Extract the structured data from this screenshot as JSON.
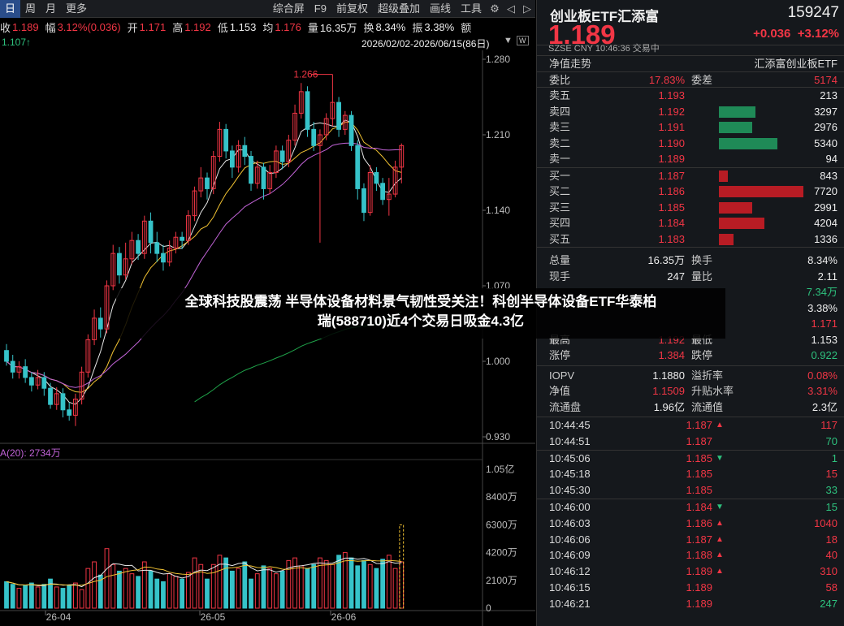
{
  "toolbar": {
    "left": [
      "日",
      "周",
      "月",
      "更多"
    ],
    "right": [
      "综合屏",
      "F9",
      "前复权",
      "超级叠加",
      "画线",
      "工具"
    ]
  },
  "info": {
    "close_label": "收",
    "close": "1.189",
    "amp_label": "幅",
    "amp": "3.12%(0.036)",
    "open_label": "开",
    "open": "1.171",
    "high_label": "高",
    "high": "1.192",
    "low_label": "低",
    "low": "1.153",
    "avg_label": "均",
    "avg": "1.176",
    "vol_label": "量",
    "vol": "16.35万",
    "turn_label": "换",
    "turn": "8.34%",
    "swing_label": "振",
    "swing": "3.38%",
    "extra_label": "额"
  },
  "range": {
    "low_mark": "1.107↑",
    "period": "2026/02/02-2026/06/15(86日)"
  },
  "vol_label": "A(20): 2734万",
  "banner": {
    "line1": "全球科技股震荡 半导体设备材料景气韧性受关注！科创半导体设备ETF华泰柏",
    "line2": "瑞(588710)近4个交易日吸金4.3亿"
  },
  "chart_data": {
    "type": "candlestick",
    "y_ticks": [
      "1.280",
      "1.210",
      "1.140",
      "1.070",
      "1.000",
      "0.930"
    ],
    "y_range": [
      0.93,
      1.28
    ],
    "vol_ticks": [
      "1.05亿",
      "8400万",
      "6300万",
      "4200万",
      "2100万",
      "0"
    ],
    "x_ticks": [
      "26-04",
      "26-05",
      "26-06"
    ],
    "max_label": "1.266",
    "candles": [
      [
        1.01,
        1.0,
        1.016,
        0.996
      ],
      [
        1.0,
        0.99,
        1.006,
        0.984
      ],
      [
        0.99,
        0.995,
        1.0,
        0.984
      ],
      [
        0.995,
        0.985,
        1.002,
        0.98
      ],
      [
        0.985,
        0.978,
        0.99,
        0.972
      ],
      [
        0.978,
        0.985,
        0.992,
        0.974
      ],
      [
        0.985,
        0.975,
        0.99,
        0.968
      ],
      [
        0.975,
        0.96,
        0.98,
        0.956
      ],
      [
        0.96,
        0.97,
        0.976,
        0.955
      ],
      [
        0.97,
        0.955,
        0.975,
        0.948
      ],
      [
        0.955,
        0.95,
        0.962,
        0.945
      ],
      [
        0.95,
        0.965,
        0.97,
        0.94
      ],
      [
        0.965,
        0.99,
        0.995,
        0.96
      ],
      [
        0.99,
        1.02,
        1.025,
        0.985
      ],
      [
        1.02,
        1.04,
        1.048,
        1.015
      ],
      [
        1.04,
        1.03,
        1.05,
        1.022
      ],
      [
        1.03,
        1.07,
        1.075,
        1.026
      ],
      [
        1.07,
        1.1,
        1.108,
        1.066
      ],
      [
        1.1,
        1.08,
        1.106,
        1.072
      ],
      [
        1.08,
        1.095,
        1.11,
        1.076
      ],
      [
        1.095,
        1.112,
        1.12,
        1.09
      ],
      [
        1.112,
        1.1,
        1.118,
        1.094
      ],
      [
        1.1,
        1.13,
        1.135,
        1.095
      ],
      [
        1.13,
        1.11,
        1.138,
        1.1
      ],
      [
        1.11,
        1.1,
        1.12,
        1.092
      ],
      [
        1.1,
        1.092,
        1.108,
        1.084
      ],
      [
        1.092,
        1.105,
        1.112,
        1.088
      ],
      [
        1.105,
        1.115,
        1.12,
        1.1
      ],
      [
        1.115,
        1.112,
        1.12,
        1.104
      ],
      [
        1.112,
        1.135,
        1.14,
        1.108
      ],
      [
        1.135,
        1.158,
        1.162,
        1.13
      ],
      [
        1.158,
        1.17,
        1.18,
        1.152
      ],
      [
        1.17,
        1.16,
        1.175,
        1.15
      ],
      [
        1.16,
        1.19,
        1.195,
        1.155
      ],
      [
        1.19,
        1.215,
        1.222,
        1.185
      ],
      [
        1.215,
        1.195,
        1.22,
        1.188
      ],
      [
        1.195,
        1.18,
        1.2,
        1.17
      ],
      [
        1.18,
        1.2,
        1.205,
        1.175
      ],
      [
        1.2,
        1.19,
        1.208,
        1.182
      ],
      [
        1.19,
        1.165,
        1.195,
        1.158
      ],
      [
        1.165,
        1.18,
        1.186,
        1.16
      ],
      [
        1.18,
        1.16,
        1.184,
        1.15
      ],
      [
        1.16,
        1.175,
        1.182,
        1.155
      ],
      [
        1.175,
        1.195,
        1.2,
        1.17
      ],
      [
        1.195,
        1.185,
        1.2,
        1.178
      ],
      [
        1.185,
        1.205,
        1.21,
        1.18
      ],
      [
        1.205,
        1.23,
        1.238,
        1.2
      ],
      [
        1.23,
        1.25,
        1.258,
        1.225
      ],
      [
        1.25,
        1.215,
        1.255,
        1.208
      ],
      [
        1.215,
        1.2,
        1.222,
        1.195
      ],
      [
        1.2,
        1.21,
        1.215,
        1.11
      ],
      [
        1.21,
        1.225,
        1.23,
        1.205
      ],
      [
        1.225,
        1.24,
        1.266,
        1.218
      ],
      [
        1.24,
        1.215,
        1.245,
        1.208
      ],
      [
        1.215,
        1.228,
        1.232,
        1.21
      ],
      [
        1.228,
        1.2,
        1.232,
        1.195
      ],
      [
        1.2,
        1.16,
        1.205,
        1.15
      ],
      [
        1.16,
        1.138,
        1.165,
        1.13
      ],
      [
        1.138,
        1.175,
        1.182,
        1.135
      ],
      [
        1.175,
        1.165,
        1.18,
        1.158
      ],
      [
        1.165,
        1.15,
        1.17,
        1.145
      ],
      [
        1.15,
        1.155,
        1.17,
        1.135
      ],
      [
        1.155,
        1.18,
        1.186,
        1.152
      ],
      [
        1.18,
        1.2,
        1.202,
        1.165
      ]
    ],
    "volumes": [
      20,
      18,
      15,
      17,
      19,
      16,
      18,
      22,
      16,
      15,
      17,
      19,
      14,
      30,
      35,
      25,
      45,
      33,
      28,
      30,
      26,
      24,
      35,
      28,
      22,
      20,
      26,
      24,
      22,
      27,
      38,
      33,
      22,
      33,
      40,
      38,
      28,
      30,
      35,
      22,
      26,
      32,
      30,
      26,
      28,
      36,
      38,
      32,
      30,
      33,
      38,
      36,
      33,
      40,
      42,
      38,
      32,
      36,
      33,
      30,
      37,
      40,
      30,
      35
    ],
    "colors": {
      "up": "#f23645",
      "down": "#36c3c9"
    }
  },
  "quote": {
    "name": "创业板ETF汇添富",
    "code": "159247",
    "price": "1.189",
    "change": "+0.036",
    "change_pct": "+3.12%",
    "sub": "SZSE   CNY   10:46:36   交易中",
    "nav_label": "净值走势",
    "fund_company": "汇添富创业板ETF",
    "weibi_label": "委比",
    "weibi": "17.83%",
    "weicha_label": "委差",
    "weicha": "5174",
    "asks": [
      {
        "label": "卖五",
        "price": "1.193",
        "vol": "213",
        "pct": 0
      },
      {
        "label": "卖四",
        "price": "1.192",
        "vol": "3297",
        "pct": 0.43
      },
      {
        "label": "卖三",
        "price": "1.191",
        "vol": "2976",
        "pct": 0.39
      },
      {
        "label": "卖二",
        "price": "1.190",
        "vol": "5340",
        "pct": 0.69
      },
      {
        "label": "卖一",
        "price": "1.189",
        "vol": "94",
        "pct": 0
      }
    ],
    "bids": [
      {
        "label": "买一",
        "price": "1.187",
        "vol": "843",
        "pct": 0.11
      },
      {
        "label": "买二",
        "price": "1.186",
        "vol": "7720",
        "pct": 1.0
      },
      {
        "label": "买三",
        "price": "1.185",
        "vol": "2991",
        "pct": 0.39
      },
      {
        "label": "买四",
        "price": "1.184",
        "vol": "4204",
        "pct": 0.54
      },
      {
        "label": "买五",
        "price": "1.183",
        "vol": "1336",
        "pct": 0.17
      }
    ],
    "stats": [
      {
        "l1": "总量",
        "v1": "16.35万",
        "c1": "white",
        "l2": "换手",
        "v2": "8.34%",
        "c2": "white"
      },
      {
        "l1": "现手",
        "v1": "247",
        "c1": "white",
        "l2": "量比",
        "v2": "2.11",
        "c2": "white"
      },
      {
        "l1": "",
        "v1": "",
        "c1": "white",
        "l2": "",
        "v2": "7.34万",
        "c2": "green"
      },
      {
        "l1": "",
        "v1": "",
        "c1": "white",
        "l2": "",
        "v2": "3.38%",
        "c2": "white"
      },
      {
        "l1": "",
        "v1": "",
        "c1": "white",
        "l2": "",
        "v2": "1.171",
        "c2": "red"
      },
      {
        "l1": "最高",
        "v1": "1.192",
        "c1": "red",
        "l2": "最低",
        "v2": "1.153",
        "c2": "white"
      },
      {
        "l1": "涨停",
        "v1": "1.384",
        "c1": "red",
        "l2": "跌停",
        "v2": "0.922",
        "c2": "green"
      }
    ],
    "extra": [
      {
        "l1": "IOPV",
        "v1": "1.1880",
        "c1": "white",
        "l2": "溢折率",
        "v2": "0.08%",
        "c2": "red"
      },
      {
        "l1": "净值",
        "v1": "1.1509",
        "c1": "red",
        "l2": "升贴水率",
        "v2": "3.31%",
        "c2": "red"
      },
      {
        "l1": "流通盘",
        "v1": "1.96亿",
        "c1": "white",
        "l2": "流通值",
        "v2": "2.3亿",
        "c2": "white"
      }
    ],
    "ticks": [
      [
        {
          "t": "10:44:45",
          "p": "1.187",
          "d": "up",
          "v": "117",
          "c": "red"
        },
        {
          "t": "10:44:51",
          "p": "1.187",
          "d": "",
          "v": "70",
          "c": "green"
        }
      ],
      [
        {
          "t": "10:45:06",
          "p": "1.185",
          "d": "down",
          "v": "1",
          "c": "green"
        },
        {
          "t": "10:45:18",
          "p": "1.185",
          "d": "",
          "v": "15",
          "c": "red"
        },
        {
          "t": "10:45:30",
          "p": "1.185",
          "d": "",
          "v": "33",
          "c": "green"
        }
      ],
      [
        {
          "t": "10:46:00",
          "p": "1.184",
          "d": "down",
          "v": "15",
          "c": "green"
        },
        {
          "t": "10:46:03",
          "p": "1.186",
          "d": "up",
          "v": "1040",
          "c": "red"
        },
        {
          "t": "10:46:06",
          "p": "1.187",
          "d": "up",
          "v": "18",
          "c": "red"
        },
        {
          "t": "10:46:09",
          "p": "1.188",
          "d": "up",
          "v": "40",
          "c": "red"
        },
        {
          "t": "10:46:12",
          "p": "1.189",
          "d": "up",
          "v": "310",
          "c": "red"
        },
        {
          "t": "10:46:15",
          "p": "1.189",
          "d": "",
          "v": "58",
          "c": "red"
        },
        {
          "t": "10:46:21",
          "p": "1.189",
          "d": "",
          "v": "247",
          "c": "green"
        }
      ]
    ]
  }
}
